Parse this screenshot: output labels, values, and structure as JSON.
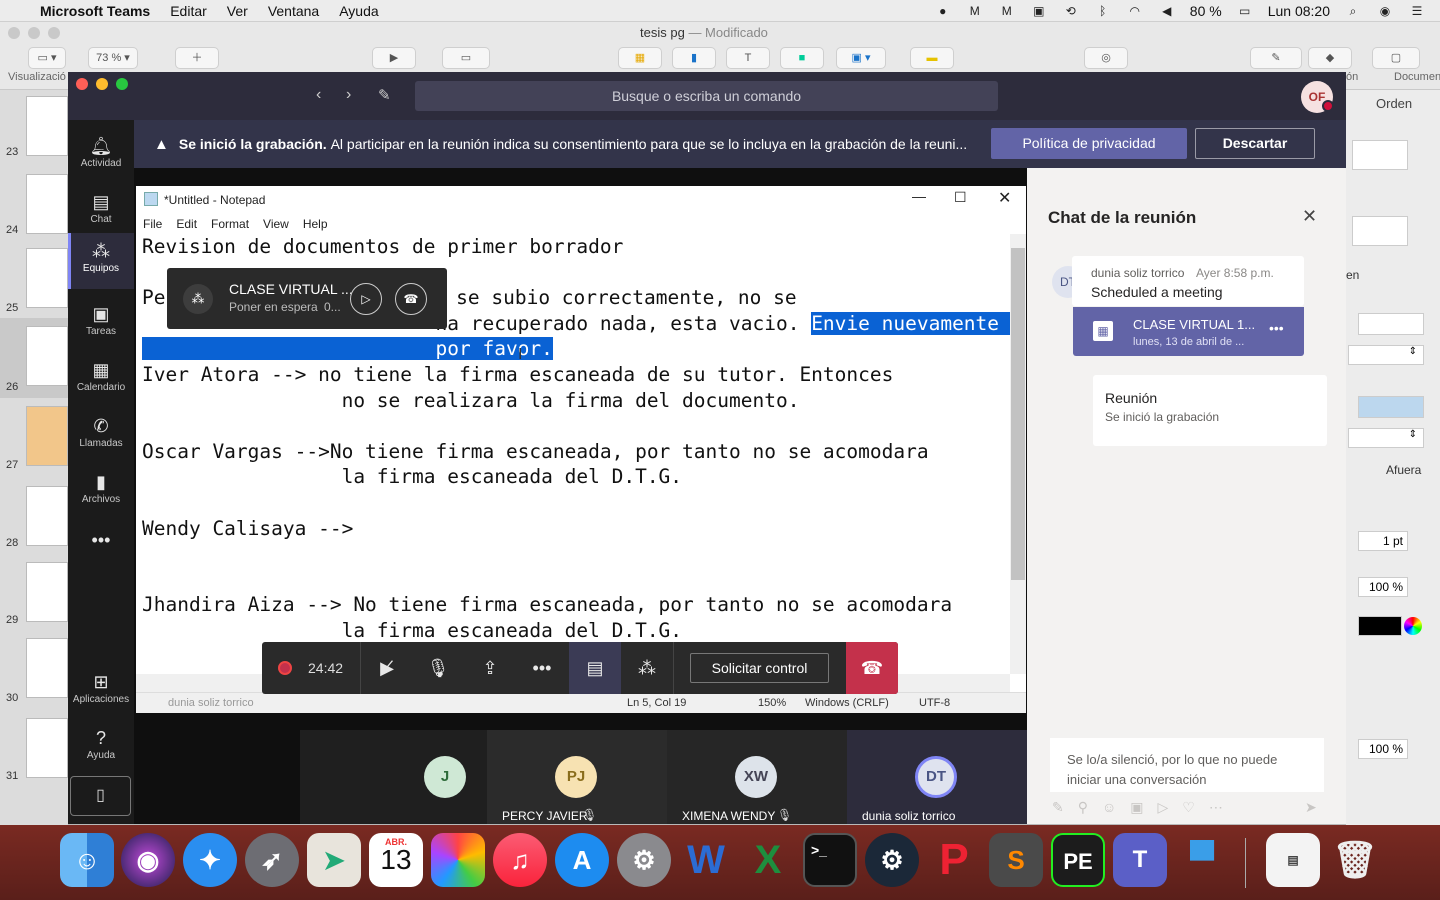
{
  "menubar": {
    "app": "Microsoft Teams",
    "items": [
      "Editar",
      "Ver",
      "Ventana",
      "Ayuda"
    ],
    "battery": "80 %",
    "clock": "Lun 08:20"
  },
  "keynote": {
    "title": "tesis pg",
    "modified": "— Modificado",
    "zoom": "73 %",
    "left_label": "Visualizació",
    "right_tab": "Documento",
    "right_tab2": "ón",
    "order": "Orden",
    "afuera": "Afuera",
    "pt": "1 pt",
    "pct1": "100 %",
    "pct2": "100 %",
    "en": "en",
    "slides": [
      "23",
      "24",
      "25",
      "26",
      "27",
      "28",
      "29",
      "30",
      "31"
    ]
  },
  "teams": {
    "search_placeholder": "Busque o escriba un comando",
    "avatar": "OF",
    "nav": [
      {
        "label": "Actividad",
        "icon": "bell-icon"
      },
      {
        "label": "Chat",
        "icon": "chat-icon"
      },
      {
        "label": "Equipos",
        "icon": "teams-icon"
      },
      {
        "label": "Tareas",
        "icon": "tasks-icon"
      },
      {
        "label": "Calendario",
        "icon": "calendar-icon"
      },
      {
        "label": "Llamadas",
        "icon": "phone-icon"
      },
      {
        "label": "Archivos",
        "icon": "file-icon"
      },
      {
        "label": "Aplicaciones",
        "icon": "apps-icon"
      },
      {
        "label": "Ayuda",
        "icon": "help-icon"
      }
    ],
    "banner": {
      "bold": "Se inició la grabación.",
      "text": "Al participar en la reunión indica su consentimiento para que se lo incluya en la grabación de la reuni...",
      "privacy": "Política de privacidad",
      "dismiss": "Descartar"
    }
  },
  "notepad": {
    "title": "*Untitled - Notepad",
    "menu": [
      "File",
      "Edit",
      "Format",
      "View",
      "Help"
    ],
    "lines": {
      "l1": "Revision de documentos de primer borrador",
      "l3a": "Pe",
      "l3b": "mento no se subio correctamente, no se",
      "l4a": "                         ha recuperado nada, esta vacio. ",
      "l4sel": "Envie nuevamente ",
      "l5sel": "                         por favor.",
      "l6": "Iver Atora --> no tiene la firma escaneada de su tutor. Entonces",
      "l7": "                 no se realizara la firma del documento.",
      "l9": "Oscar Vargas -->No tiene firma escaneada, por tanto no se acomodara",
      "l10": "                 la firma escaneada del D.T.G.",
      "l12": "Wendy Calisaya -->",
      "l15": "Jhandira Aiza --> No tiene firma escaneada, por tanto no se acomodara",
      "l16": "                 la firma escaneada del D.T.G."
    },
    "status": {
      "pos": "Ln 5, Col 19",
      "zoom": "150%",
      "eol": "Windows (CRLF)",
      "enc": "UTF-8",
      "presenter": "dunia soliz torrico"
    }
  },
  "mini_meeting": {
    "title": "CLASE VIRTUAL ...",
    "subtitle": "Poner en espera",
    "extra": "0..."
  },
  "controls": {
    "timer": "24:42",
    "request": "Solicitar control"
  },
  "participants": [
    {
      "initials": "J",
      "name": ""
    },
    {
      "initials": "PJ",
      "name": "PERCY JAVIER"
    },
    {
      "initials": "XW",
      "name": "XIMENA WENDY"
    },
    {
      "initials": "DT",
      "name": "dunia soliz torrico"
    }
  ],
  "chat": {
    "title": "Chat de la reunión",
    "msg1": {
      "avatar": "DT",
      "author": "dunia soliz torrico",
      "time": "Ayer 8:58 p.m.",
      "text": "Scheduled a meeting",
      "card_title": "CLASE VIRTUAL 1...",
      "card_date": "lunes, 13 de abril de ..."
    },
    "msg2": {
      "title": "Reunión",
      "text": "Se inició la grabación"
    },
    "compose_line1": "Se lo/a silenció, por lo que no puede",
    "compose_line2": "iniciar una conversación"
  },
  "dock": {
    "calendar_month": "ABR.",
    "calendar_day": "13"
  },
  "colors": {
    "teams_purple": "#6264a7",
    "selection": "#0a62d4",
    "hangup": "#c4314b"
  }
}
